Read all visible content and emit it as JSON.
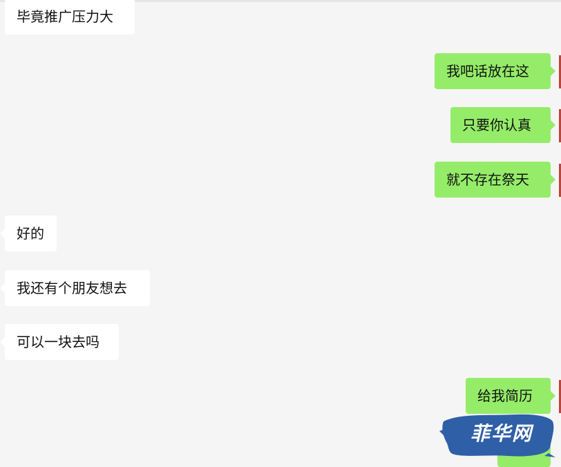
{
  "colors": {
    "background": "#f5f5f5",
    "incoming_bubble": "#ffffff",
    "outgoing_bubble": "#95ec69",
    "watermark": "#2f5fa7"
  },
  "messages": [
    {
      "side": "left",
      "text": "毕竟推广压力大"
    },
    {
      "side": "right",
      "text": "我吧话放在这"
    },
    {
      "side": "right",
      "text": "只要你认真"
    },
    {
      "side": "right",
      "text": "就不存在祭天"
    },
    {
      "side": "left",
      "text": "好的"
    },
    {
      "side": "left",
      "text": "我还有个朋友想去"
    },
    {
      "side": "left",
      "text": "可以一块去吗"
    },
    {
      "side": "right",
      "text": "给我简历"
    }
  ],
  "watermark": {
    "text": "菲华网"
  }
}
